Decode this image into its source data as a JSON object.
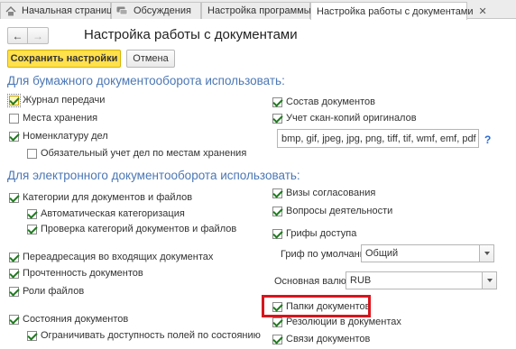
{
  "tabs": [
    {
      "label": "Начальная страница",
      "icon": "home-icon"
    },
    {
      "label": "Обсуждения",
      "icon": "chat-icon"
    },
    {
      "label": "Настройка программы",
      "icon": ""
    },
    {
      "label": "Настройка работы с документами",
      "icon": "",
      "close": "✕"
    }
  ],
  "nav": {
    "back": "←",
    "forward": "→"
  },
  "page_title": "Настройка работы с документами",
  "toolbar": {
    "save": "Сохранить настройки",
    "cancel": "Отмена"
  },
  "paper": {
    "heading": "Для бумажного документооборота использовать:",
    "left": [
      {
        "label": "Журнал передачи",
        "checked": true
      },
      {
        "label": "Места хранения",
        "checked": false
      },
      {
        "label": "Номенклатуру дел",
        "checked": true
      },
      {
        "label": "Обязательный учет дел по местам хранения",
        "checked": false
      }
    ],
    "right": [
      {
        "label": "Состав документов",
        "checked": true
      },
      {
        "label": "Учет скан-копий оригиналов",
        "checked": true
      }
    ],
    "scan_formats": "bmp, gif, jpeg, jpg, png, tiff, tif, wmf, emf, pdf",
    "help": "?"
  },
  "electronic": {
    "heading": "Для электронного документооборота использовать:",
    "left": [
      {
        "label": "Категории для документов и файлов",
        "checked": true
      },
      {
        "label": "Автоматическая категоризация",
        "checked": true
      },
      {
        "label": "Проверка категорий документов и файлов",
        "checked": true
      },
      {
        "label": "Переадресация во входящих документах",
        "checked": true
      },
      {
        "label": "Прочтенность документов",
        "checked": true
      },
      {
        "label": "Роли файлов",
        "checked": true
      },
      {
        "label": "Состояния документов",
        "checked": true
      },
      {
        "label": "Ограничивать доступность полей по состоянию",
        "checked": true
      }
    ],
    "right": [
      {
        "label": "Визы согласования",
        "checked": true
      },
      {
        "label": "Вопросы деятельности",
        "checked": true
      },
      {
        "label": "Грифы доступа",
        "checked": true
      },
      {
        "label": "Папки документов",
        "checked": true
      },
      {
        "label": "Резолюции в документах",
        "checked": true
      },
      {
        "label": "Связи документов",
        "checked": true
      }
    ],
    "default_stamp": {
      "label": "Гриф по умолчанию:",
      "value": "Общий"
    },
    "currency": {
      "label": "Основная валюта:",
      "value": "RUB"
    }
  }
}
